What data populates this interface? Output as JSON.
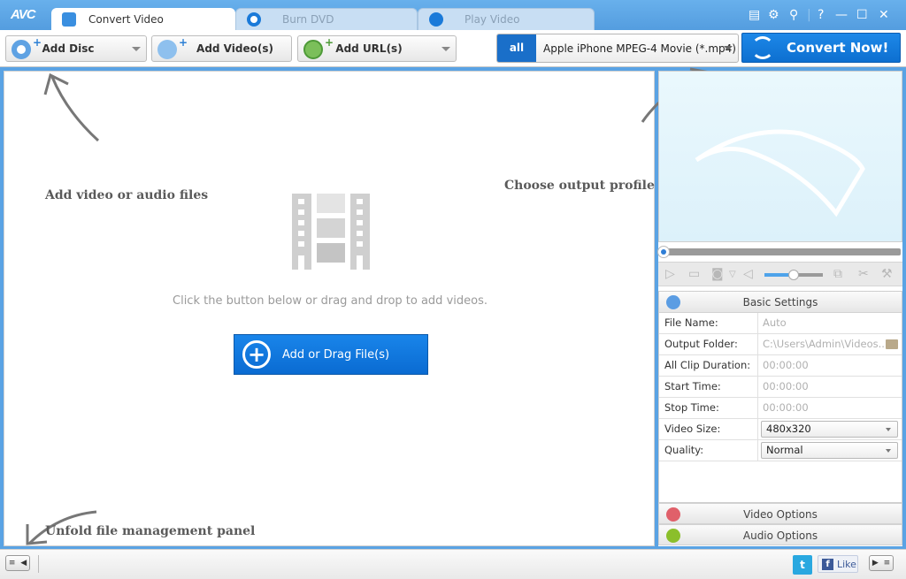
{
  "app": {
    "logo": "AVC"
  },
  "tabs": [
    {
      "label": "Convert Video",
      "icon": "refresh-icon",
      "active": true
    },
    {
      "label": "Burn DVD",
      "icon": "disc-icon",
      "active": false
    },
    {
      "label": "Play Video",
      "icon": "play-icon",
      "active": false
    }
  ],
  "window_controls": {
    "help": "?",
    "minimize": "—",
    "maximize": "☐",
    "close": "✕"
  },
  "toolbar": {
    "add_disc": "Add Disc",
    "add_videos": "Add Video(s)",
    "add_url": "Add URL(s)",
    "profile_icon_text": "all",
    "profile": "Apple iPhone MPEG-4 Movie (*.mp4)",
    "convert": "Convert Now!"
  },
  "main": {
    "hint_add": "Add video or audio files",
    "hint_profile": "Choose output profile and convert",
    "hint_unfold": "Unfold file management panel",
    "description": "Click the button below or drag and drop to add videos.",
    "add_button": "Add or Drag File(s)"
  },
  "player": {
    "seek_progress": 0,
    "volume": 0.5
  },
  "settings": {
    "header": "Basic Settings",
    "rows": [
      {
        "label": "File Name:",
        "value": "Auto"
      },
      {
        "label": "Output Folder:",
        "value": "C:\\Users\\Admin\\Videos..."
      },
      {
        "label": "All Clip Duration:",
        "value": "00:00:00"
      },
      {
        "label": "Start Time:",
        "value": "00:00:00"
      },
      {
        "label": "Stop Time:",
        "value": "00:00:00"
      },
      {
        "label": "Video Size:",
        "value": "480x320"
      },
      {
        "label": "Quality:",
        "value": "Normal"
      }
    ],
    "video_options": "Video Options",
    "audio_options": "Audio Options"
  },
  "statusbar": {
    "like": "Like"
  },
  "colors": {
    "accent": "#0d6fd0",
    "titlebar": "#5aa3e4"
  }
}
